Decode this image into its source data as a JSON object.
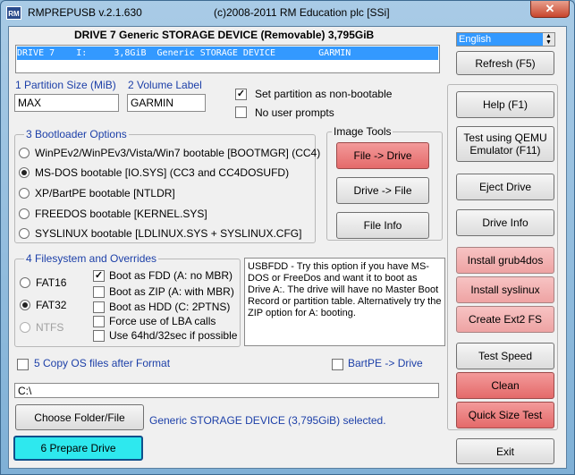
{
  "window": {
    "app_icon": "RM",
    "title": "RMPREPUSB v.2.1.630",
    "copyright": "(c)2008-2011 RM Education plc [SSi]",
    "close_glyph": "✕"
  },
  "drive": {
    "heading": "DRIVE 7 Generic STORAGE DEVICE  (Removable) 3,795GiB",
    "list_row": "DRIVE 7    I:     3,8GiB  Generic STORAGE DEVICE        GARMIN"
  },
  "language": {
    "selected": "English"
  },
  "partition": {
    "size_label": "1 Partition Size (MiB)",
    "size_value": "MAX",
    "volume_label": "2 Volume Label",
    "volume_value": "GARMIN",
    "non_bootable_label": "Set partition as non-bootable",
    "non_bootable_checked": true,
    "no_prompts_label": "No user prompts",
    "no_prompts_checked": false
  },
  "bootloader": {
    "title": "3 Bootloader Options",
    "options": [
      {
        "label": "WinPEv2/WinPEv3/Vista/Win7 bootable [BOOTMGR] (CC4)",
        "selected": false
      },
      {
        "label": "MS-DOS bootable [IO.SYS]    (CC3 and CC4DOSUFD)",
        "selected": true
      },
      {
        "label": "XP/BartPE bootable [NTLDR]",
        "selected": false
      },
      {
        "label": "FREEDOS bootable [KERNEL.SYS]",
        "selected": false
      },
      {
        "label": "SYSLINUX bootable [LDLINUX.SYS + SYSLINUX.CFG]",
        "selected": false
      }
    ]
  },
  "image_tools": {
    "title": "Image Tools",
    "file_to_drive": "File -> Drive",
    "drive_to_file": "Drive -> File",
    "file_info": "File Info"
  },
  "filesystem": {
    "title": "4 Filesystem and Overrides",
    "fat16": "FAT16",
    "fat32": "FAT32",
    "ntfs": "NTFS",
    "overrides": [
      {
        "label": "Boot as FDD (A: no MBR)",
        "checked": true
      },
      {
        "label": "Boot as ZIP (A: with MBR)",
        "checked": false
      },
      {
        "label": "Boot as HDD (C: 2PTNS)",
        "checked": false
      },
      {
        "label": "Force use of LBA calls",
        "checked": false
      },
      {
        "label": "Use 64hd/32sec if possible",
        "checked": false
      }
    ]
  },
  "info_text": "USBFDD - Try this option if you have MS-DOS or FreeDos and want it to boot as Drive A:. The drive will have no Master Boot Record or partition table. Alternatively try the ZIP option for A: booting.",
  "copy_os": {
    "label": "5 Copy OS files after Format",
    "checked": false
  },
  "bartpe": {
    "label": "BartPE -> Drive",
    "checked": false
  },
  "path": {
    "value": "C:\\"
  },
  "choose_folder": "Choose Folder/File",
  "status": "Generic STORAGE DEVICE (3,795GiB) selected.",
  "prepare": "6 Prepare Drive",
  "right": {
    "refresh": "Refresh (F5)",
    "help": "Help (F1)",
    "qemu": "Test using QEMU Emulator (F11)",
    "eject": "Eject Drive",
    "drive_info": "Drive Info",
    "grub4dos": "Install grub4dos",
    "syslinux": "Install syslinux",
    "ext2": "Create Ext2 FS",
    "test_speed": "Test Speed",
    "clean": "Clean",
    "quick_size": "Quick Size Test",
    "exit": "Exit"
  }
}
